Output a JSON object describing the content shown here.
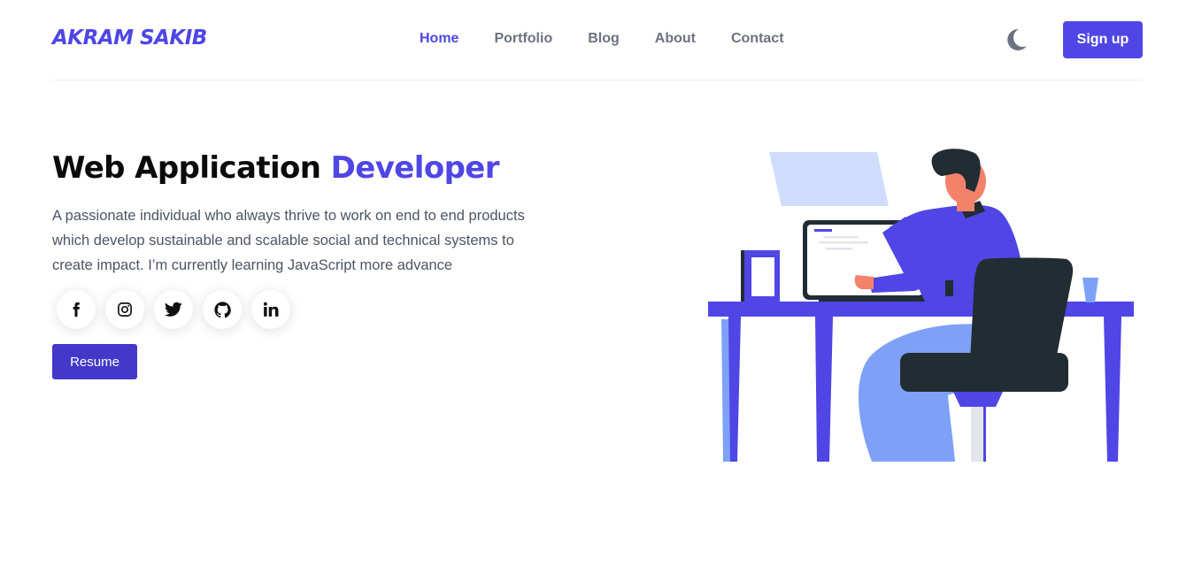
{
  "brand": {
    "logo": "AKRAM SAKIB",
    "accent_color": "#4f46e5"
  },
  "nav": {
    "items": [
      {
        "label": "Home",
        "active": true
      },
      {
        "label": "Portfolio",
        "active": false
      },
      {
        "label": "Blog",
        "active": false
      },
      {
        "label": "About",
        "active": false
      },
      {
        "label": "Contact",
        "active": false
      }
    ],
    "theme_toggle_icon": "moon-icon",
    "signup_label": "Sign up"
  },
  "hero": {
    "title_main": "Web Application",
    "title_accent": "Developer",
    "description": "A passionate individual who always thrive to work on end to end products which develop sustainable and scalable social and technical systems to create impact. I’m currently learning JavaScript more advance",
    "socials": [
      {
        "name": "facebook",
        "icon": "facebook-icon"
      },
      {
        "name": "instagram",
        "icon": "instagram-icon"
      },
      {
        "name": "twitter",
        "icon": "twitter-icon"
      },
      {
        "name": "github",
        "icon": "github-icon"
      },
      {
        "name": "linkedin",
        "icon": "linkedin-icon"
      }
    ],
    "resume_label": "Resume",
    "illustration": "developer-at-desk-illustration"
  }
}
